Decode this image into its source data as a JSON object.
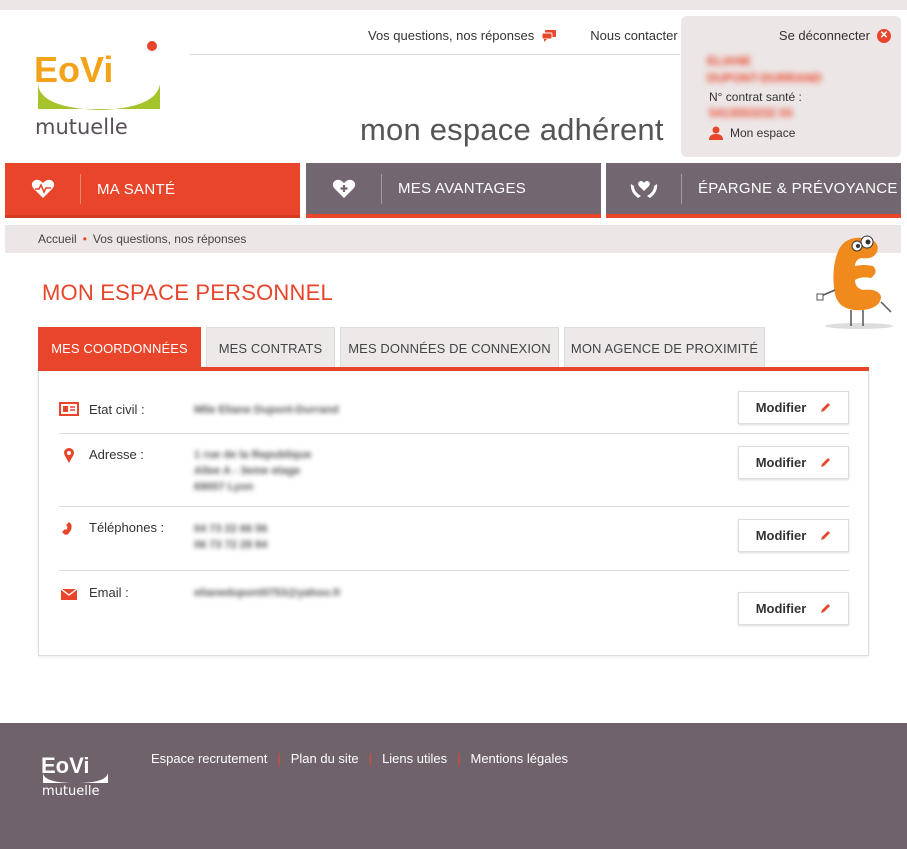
{
  "header": {
    "logo_text": "EoVi",
    "logo_sub": "mutuelle",
    "links": [
      {
        "label": "Vos questions, nos réponses",
        "icon": "chat-icon"
      },
      {
        "label": "Nous contacter",
        "icon": "envelope-icon"
      }
    ],
    "site_title": "mon espace adhérent"
  },
  "user": {
    "logout_label": "Se déconnecter",
    "name_line1": "ELIANE",
    "name_line2": "DUPONT-DURRAND",
    "contract_label": "N° contrat santé :",
    "contract_number": "5413553232 03",
    "my_space_label": "Mon espace"
  },
  "nav": [
    {
      "label": "MA SANTÉ",
      "icon": "heart-pulse-icon"
    },
    {
      "label": "MES AVANTAGES",
      "icon": "heart-plus-icon"
    },
    {
      "label": "ÉPARGNE & PRÉVOYANCE",
      "icon": "hands-heart-icon"
    }
  ],
  "breadcrumb": {
    "home": "Accueil",
    "current": "Vos questions, nos réponses"
  },
  "page_title": "MON ESPACE PERSONNEL",
  "tabs": [
    {
      "label": "MES COORDONNÉES",
      "active": true
    },
    {
      "label": "MES CONTRATS",
      "active": false
    },
    {
      "label": "MES DONNÉES DE CONNEXION",
      "active": false
    },
    {
      "label": "MON AGENCE DE PROXIMITÉ",
      "active": false
    }
  ],
  "rows": [
    {
      "label": "Etat civil :",
      "icon": "id-card-icon",
      "values": [
        "Mlle Eliane Dupont-Durrand"
      ],
      "button": "Modifier"
    },
    {
      "label": "Adresse :",
      "icon": "location-pin-icon",
      "values": [
        "1 rue de la Republique",
        "Allee A - 3eme etage",
        "69007 Lyon"
      ],
      "button": "Modifier"
    },
    {
      "label": "Téléphones :",
      "icon": "phone-icon",
      "values": [
        "04 73 22 66 56",
        "06 73 72 28 84"
      ],
      "button": "Modifier"
    },
    {
      "label": "Email :",
      "icon": "envelope-icon",
      "values": [
        "elianedupont0753@yahoo.fr"
      ],
      "button": "Modifier"
    }
  ],
  "footer": {
    "logo_text": "EoVi",
    "logo_sub": "mutuelle",
    "links": [
      "Espace recrutement",
      "Plan du site",
      "Liens utiles",
      "Mentions légales"
    ]
  },
  "colors": {
    "accent": "#e8452a",
    "nav_grey": "#726670",
    "footer": "#6f626b",
    "panel_bg": "#ede6e6"
  }
}
